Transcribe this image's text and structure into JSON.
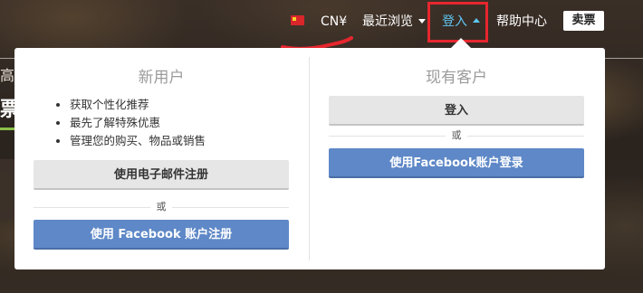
{
  "background": {
    "text_line_1": "高士",
    "text_line_2": "票"
  },
  "topnav": {
    "flag": "china-flag",
    "currency": "CN¥",
    "recent": "最近浏览",
    "login": "登入",
    "help": "帮助中心",
    "sell": "卖票"
  },
  "dropdown": {
    "new_user": {
      "title": "新用户",
      "benefits": [
        "获取个性化推荐",
        "最先了解特殊优惠",
        "管理您的购买、物品或销售"
      ],
      "email_signup": "使用电子邮件注册",
      "or": "或",
      "facebook_signup": "使用 Facebook 账户注册"
    },
    "existing_user": {
      "title": "现有客户",
      "login": "登入",
      "or": "或",
      "facebook_login": "使用Facebook账户登录"
    }
  },
  "colors": {
    "accent_blue_text": "#5ec6f2",
    "button_blue": "#5e88c7",
    "highlight_red": "#e6262e"
  }
}
